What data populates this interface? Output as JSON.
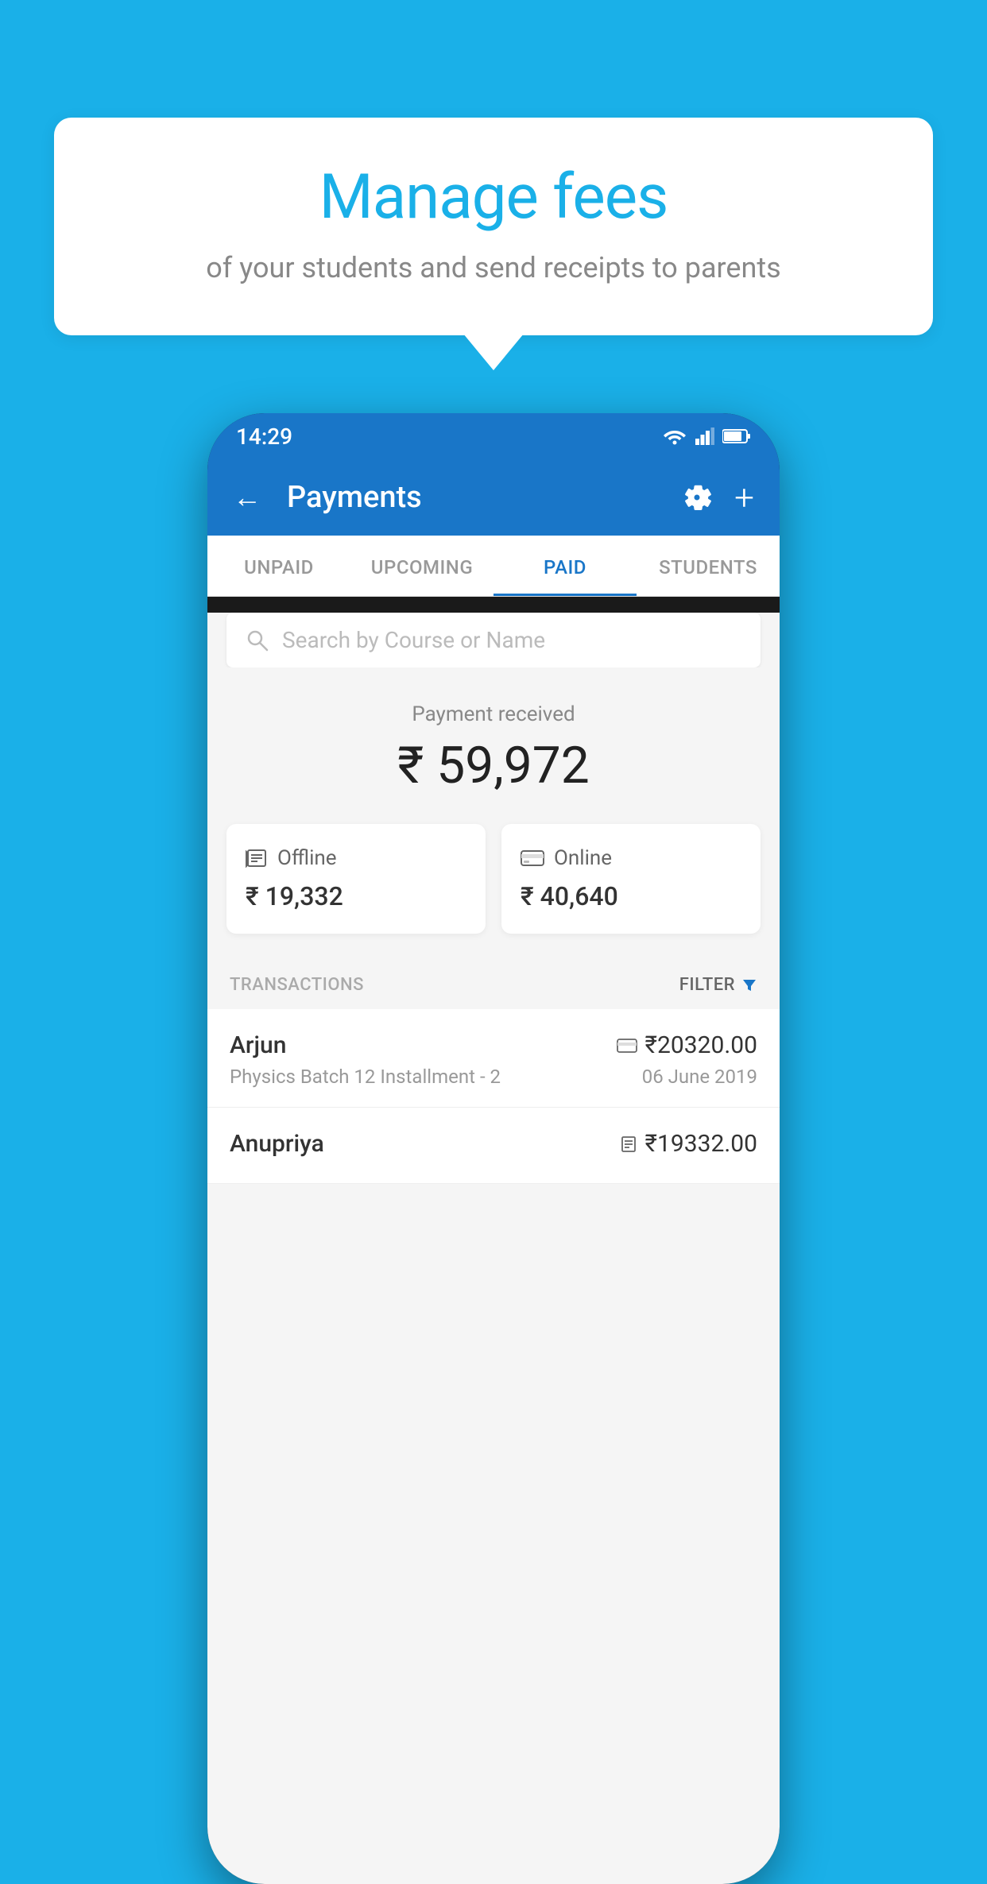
{
  "background_color": "#1ab0e8",
  "speech_bubble": {
    "title": "Manage fees",
    "subtitle": "of your students and send receipts to parents"
  },
  "phone": {
    "status_bar": {
      "time": "14:29",
      "icons": [
        "wifi",
        "signal",
        "battery"
      ]
    },
    "header": {
      "title": "Payments",
      "back_label": "←",
      "settings_icon": "⚙",
      "add_icon": "+"
    },
    "tabs": [
      {
        "label": "UNPAID",
        "active": false
      },
      {
        "label": "UPCOMING",
        "active": false
      },
      {
        "label": "PAID",
        "active": true
      },
      {
        "label": "STUDENTS",
        "active": false
      }
    ],
    "search": {
      "placeholder": "Search by Course or Name"
    },
    "payment_received": {
      "label": "Payment received",
      "amount": "₹ 59,972"
    },
    "payment_cards": [
      {
        "type": "Offline",
        "icon": "offline",
        "amount": "₹ 19,332"
      },
      {
        "type": "Online",
        "icon": "online",
        "amount": "₹ 40,640"
      }
    ],
    "transactions": {
      "label": "TRANSACTIONS",
      "filter_label": "FILTER"
    },
    "transaction_items": [
      {
        "name": "Arjun",
        "course": "Physics Batch 12 Installment - 2",
        "amount": "₹20320.00",
        "date": "06 June 2019",
        "payment_mode": "online"
      },
      {
        "name": "Anupriya",
        "course": "",
        "amount": "₹19332.00",
        "date": "",
        "payment_mode": "offline"
      }
    ]
  }
}
